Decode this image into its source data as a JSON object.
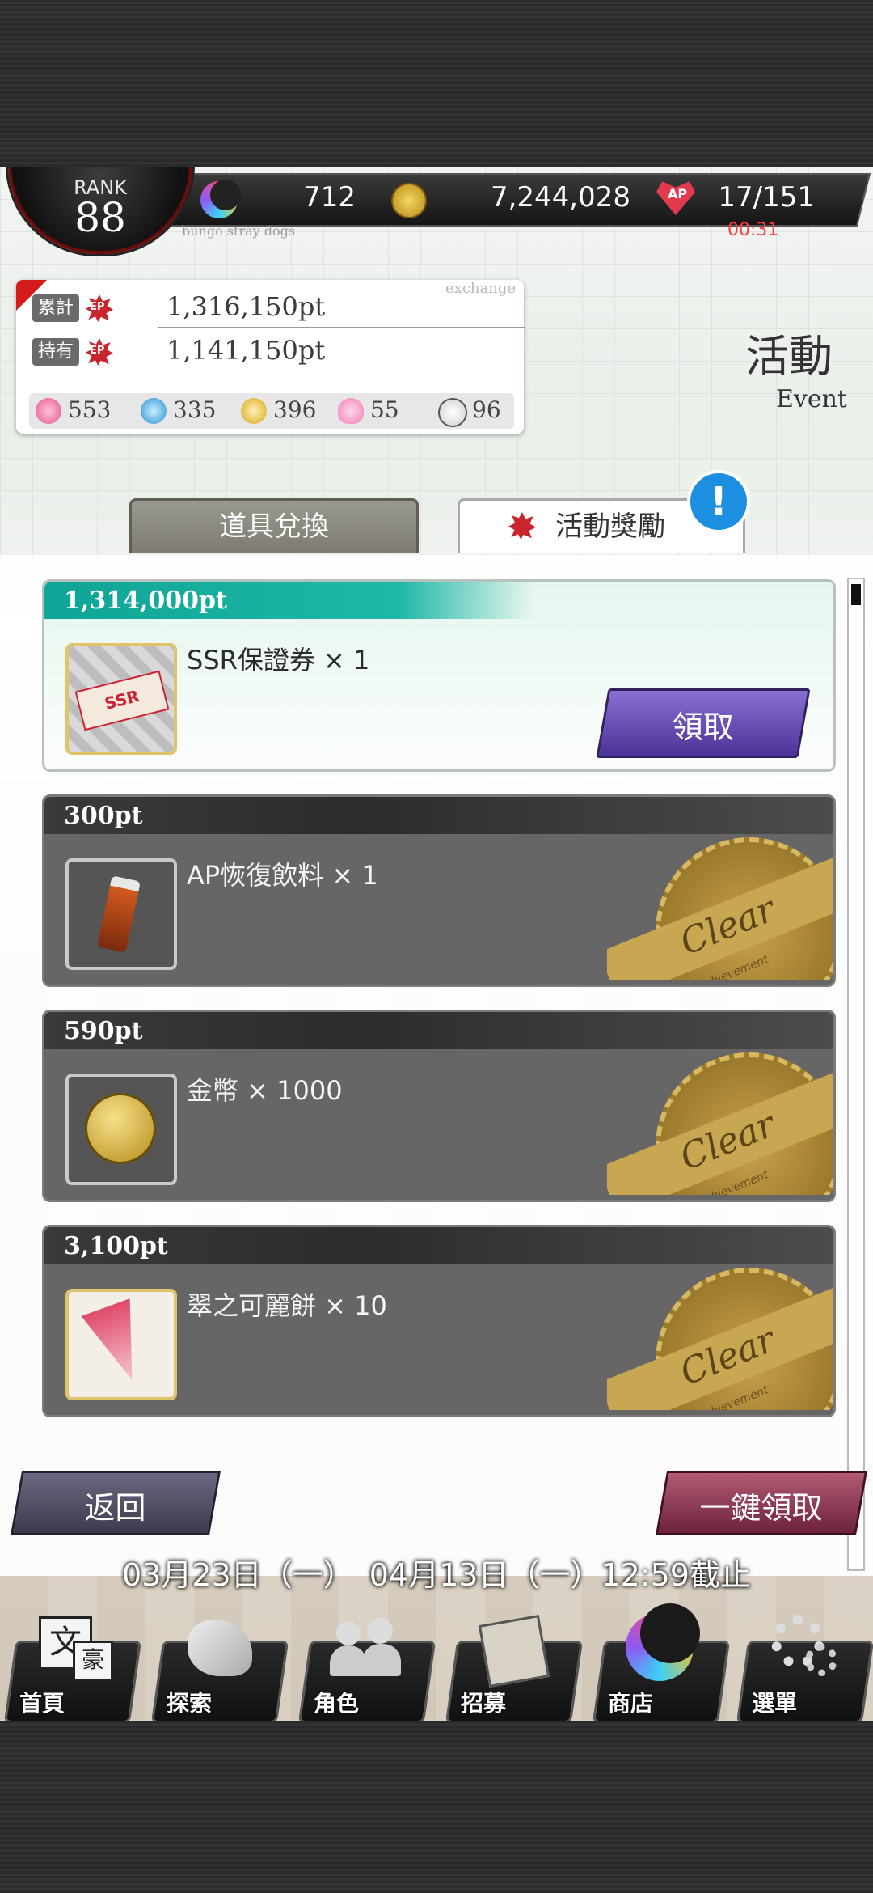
{
  "status": {
    "rank_label": "RANK",
    "rank_value": "88",
    "crystals": "712",
    "coins": "7,244,028",
    "ap_icon_text": "AP",
    "ap": "17/151",
    "timer": "00:31",
    "brand": "bungo stray dogs"
  },
  "points_card": {
    "exchange_label": "exchange",
    "total_label": "累計",
    "total_value": "1,316,150pt",
    "held_label": "持有",
    "held_value": "1,141,150pt",
    "ep_icon_text": "EP",
    "items": [
      {
        "icon": "pink-gem-icon",
        "value": "553"
      },
      {
        "icon": "blue-gem-icon",
        "value": "335"
      },
      {
        "icon": "gold-gem-icon",
        "value": "396"
      },
      {
        "icon": "rabbit-icon",
        "value": "55"
      },
      {
        "icon": "dog-icon",
        "value": "96"
      }
    ]
  },
  "page_title": {
    "cn": "活動",
    "en": "Event"
  },
  "tabs": {
    "exchange": "道具兌換",
    "rewards": "活動獎勵",
    "badge": "!"
  },
  "rewards": [
    {
      "points": "1,314,000pt",
      "name": "SSR保證券 × 1",
      "state": "claimable",
      "button": "領取",
      "icon": "ssr-ticket-icon"
    },
    {
      "points": "300pt",
      "name": "AP恢復飲料 × 1",
      "state": "cleared",
      "stamp": "Clear",
      "stamp_sub": "Achievement",
      "icon": "ap-drink-icon"
    },
    {
      "points": "590pt",
      "name": "金幣 × 1000",
      "state": "cleared",
      "stamp": "Clear",
      "stamp_sub": "Achievement",
      "icon": "gold-coin-icon"
    },
    {
      "points": "3,100pt",
      "name": "翠之可麗餅 × 10",
      "state": "cleared",
      "stamp": "Clear",
      "stamp_sub": "Achievement",
      "icon": "crepe-icon"
    }
  ],
  "actions": {
    "back": "返回",
    "claim_all": "一鍵領取"
  },
  "period": "03月23日（一）　04月13日（一）12:59截止",
  "nav": [
    {
      "label": "首頁",
      "icon": "home-icon"
    },
    {
      "label": "探索",
      "icon": "tiger-icon"
    },
    {
      "label": "角色",
      "icon": "characters-icon"
    },
    {
      "label": "招募",
      "icon": "recruit-book-icon"
    },
    {
      "label": "商店",
      "icon": "shop-moon-icon"
    },
    {
      "label": "選單",
      "icon": "settings-gear-icon"
    }
  ]
}
